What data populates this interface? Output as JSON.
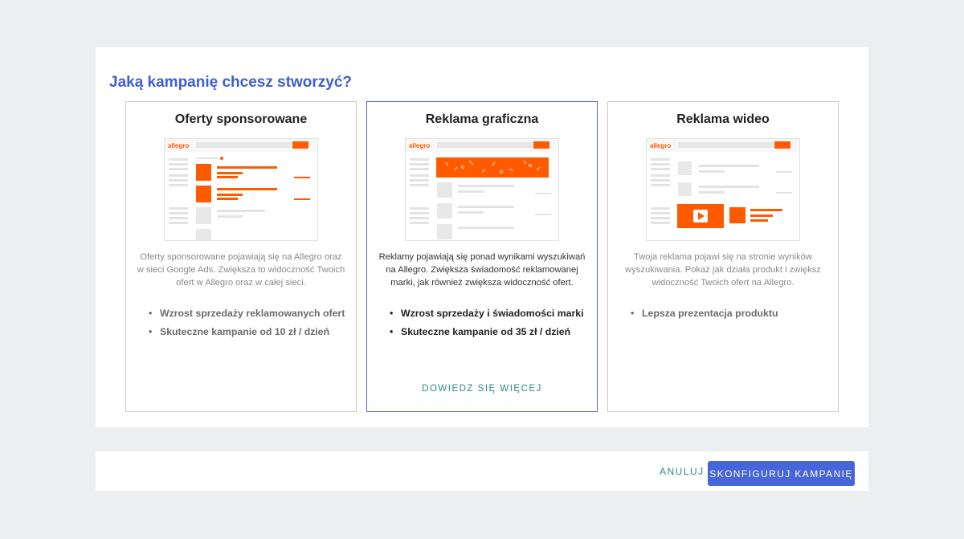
{
  "dialog": {
    "title": "Jaką kampanię chcesz stworzyć?"
  },
  "cards": [
    {
      "title": "Oferty sponsorowane",
      "mock_logo": "allegro",
      "description": "Oferty sponsorowane pojawiają się na Allegro oraz w sieci Google Ads. Zwiększa to widoczność Twoich ofert w Allegro oraz w całej sieci.",
      "bullets": [
        "Wzrost sprzedaży reklamowanych ofert",
        "Skuteczne kampanie od 10 zł / dzień"
      ],
      "selected": false
    },
    {
      "title": "Reklama graficzna",
      "mock_logo": "allegro",
      "description": "Reklamy pojawiają się ponad wynikami wyszukiwań na Allegro. Zwiększa świadomość reklamowanej marki, jak również zwiększa widoczność ofert.",
      "bullets": [
        "Wzrost sprzedaży i świadomości marki",
        "Skuteczne kampanie od 35 zł / dzień"
      ],
      "link": "DOWIEDZ SIĘ WIĘCEJ",
      "selected": true
    },
    {
      "title": "Reklama wideo",
      "mock_logo": "allegro",
      "description": "Twoja reklama pojawi się na stronie wyników wyszukiwania. Pokaż jak działa produkt i zwiększ widoczność Twoich ofert na Allegro.",
      "bullets": [
        "Lepsza prezentacja produktu"
      ],
      "selected": false
    }
  ],
  "footer": {
    "cancel_label": "ANULUJ",
    "configure_label": "SKONFIGURUJ KAMPANIĘ"
  },
  "colors": {
    "accent": "#4565d8",
    "title": "#3f5fce",
    "allegro_orange": "#ff5a00",
    "link": "#2b8a86",
    "background": "#eceeef"
  }
}
